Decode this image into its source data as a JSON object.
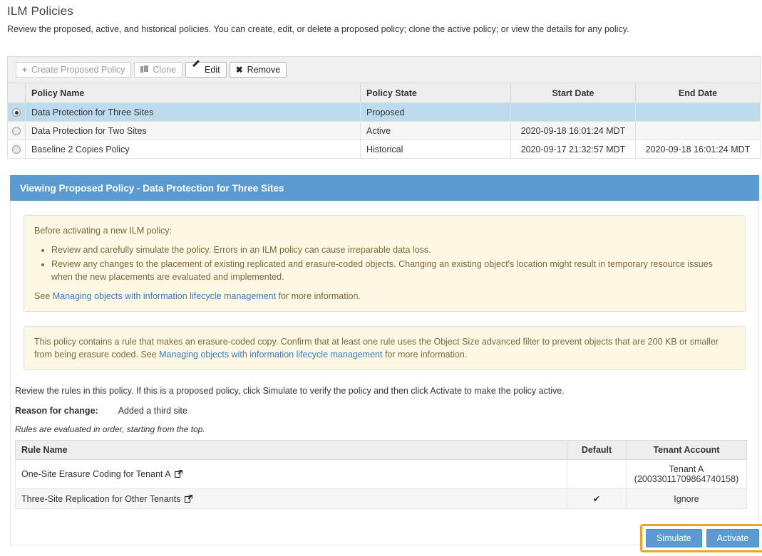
{
  "header": {
    "title": "ILM Policies",
    "subtitle": "Review the proposed, active, and historical policies. You can create, edit, or delete a proposed policy; clone the active policy; or view the details for any policy."
  },
  "toolbar": {
    "create_label": "Create Proposed Policy",
    "clone_label": "Clone",
    "edit_label": "Edit",
    "remove_label": "Remove"
  },
  "policy_table": {
    "columns": [
      "Policy Name",
      "Policy State",
      "Start Date",
      "End Date"
    ],
    "rows": [
      {
        "selected": true,
        "name": "Data Protection for Three Sites",
        "state": "Proposed",
        "start": "",
        "end": ""
      },
      {
        "selected": false,
        "name": "Data Protection for Two Sites",
        "state": "Active",
        "start": "2020-09-18 16:01:24 MDT",
        "end": ""
      },
      {
        "selected": false,
        "name": "Baseline 2 Copies Policy",
        "state": "Historical",
        "start": "2020-09-17 21:32:57 MDT",
        "end": "2020-09-18 16:01:24 MDT"
      }
    ]
  },
  "panel": {
    "title": "Viewing Proposed Policy - Data Protection for Three Sites",
    "alert1": {
      "intro": "Before activating a new ILM policy:",
      "bullets": [
        "Review and carefully simulate the policy. Errors in an ILM policy can cause irreparable data loss.",
        "Review any changes to the placement of existing replicated and erasure-coded objects. Changing an existing object's location might result in temporary resource issues when the new placements are evaluated and implemented."
      ],
      "see_prefix": "See ",
      "see_link": "Managing objects with information lifecycle management",
      "see_suffix": " for more information."
    },
    "alert2": {
      "text_before": "This policy contains a rule that makes an erasure-coded copy. Confirm that at least one rule uses the Object Size advanced filter to prevent objects that are 200 KB or smaller from being erasure coded. See ",
      "link": "Managing objects with information lifecycle management",
      "text_after": " for more information."
    },
    "review_text": "Review the rules in this policy. If this is a proposed policy, click Simulate to verify the policy and then click Activate to make the policy active.",
    "reason_label": "Reason for change:",
    "reason_value": "Added a third site",
    "order_note": "Rules are evaluated in order, starting from the top.",
    "rules_table": {
      "columns": [
        "Rule Name",
        "Default",
        "Tenant Account"
      ],
      "rows": [
        {
          "name": "One-Site Erasure Coding for Tenant A",
          "default": "",
          "tenant_line1": "Tenant A",
          "tenant_line2": "(20033011709864740158)"
        },
        {
          "name": "Three-Site Replication for Other Tenants",
          "default": "✔",
          "tenant_line1": "Ignore",
          "tenant_line2": ""
        }
      ]
    },
    "actions": {
      "simulate_label": "Simulate",
      "activate_label": "Activate"
    }
  },
  "colors": {
    "panel_header": "#5b9bd1",
    "selected_row": "#bcdcee",
    "alert_bg": "#fdf8e3",
    "highlight_border": "#f0a41e",
    "link": "#3a7bbf"
  }
}
